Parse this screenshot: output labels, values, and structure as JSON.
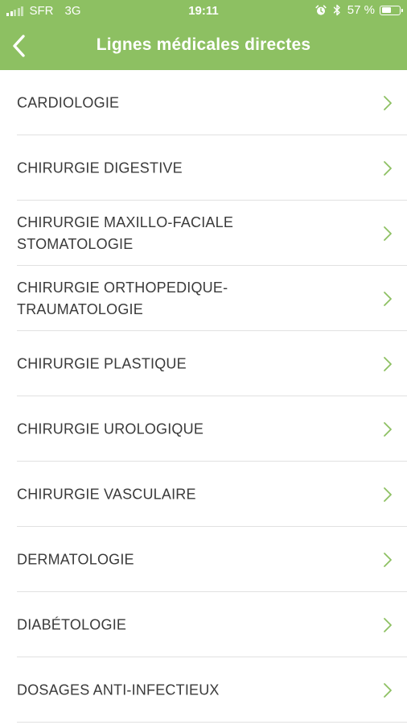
{
  "status_bar": {
    "carrier": "SFR",
    "network": "3G",
    "time": "19:11",
    "battery_percent": "57 %",
    "battery_level": 0.57,
    "signal_bars": 2,
    "icons": [
      "signal-icon",
      "alarm-icon",
      "bluetooth-icon",
      "battery-icon"
    ]
  },
  "nav": {
    "title": "Lignes médicales directes",
    "back_icon": "chevron-left-icon"
  },
  "colors": {
    "accent": "#8dc062",
    "chevron": "#8dc062",
    "text": "#3a3a3a",
    "divider": "#e1e1e1"
  },
  "list": {
    "items": [
      {
        "line1": "CARDIOLOGIE",
        "line2": ""
      },
      {
        "line1": "CHIRURGIE DIGESTIVE",
        "line2": ""
      },
      {
        "line1": "CHIRURGIE MAXILLO-FACIALE",
        "line2": "STOMATOLOGIE"
      },
      {
        "line1": "CHIRURGIE ORTHOPEDIQUE-",
        "line2": "TRAUMATOLOGIE"
      },
      {
        "line1": "CHIRURGIE PLASTIQUE",
        "line2": ""
      },
      {
        "line1": "CHIRURGIE UROLOGIQUE",
        "line2": ""
      },
      {
        "line1": "CHIRURGIE VASCULAIRE",
        "line2": ""
      },
      {
        "line1": "DERMATOLOGIE",
        "line2": ""
      },
      {
        "line1": "DIABÉTOLOGIE",
        "line2": ""
      },
      {
        "line1": "DOSAGES ANTI-INFECTIEUX",
        "line2": ""
      }
    ]
  }
}
